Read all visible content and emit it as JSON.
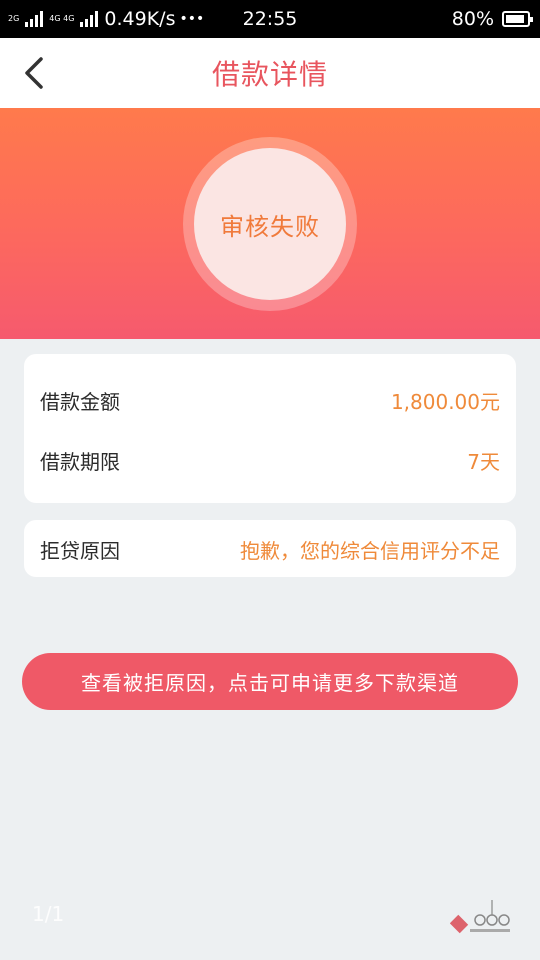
{
  "status_bar": {
    "net_tags": [
      "2G",
      "4G 4G"
    ],
    "speed": "0.49K/s",
    "dots": "•••",
    "time": "22:55",
    "battery_pct": "80%"
  },
  "nav": {
    "back_icon": "chevron-left-icon",
    "title": "借款详情"
  },
  "hero": {
    "status": "审核失败"
  },
  "details": {
    "rows": [
      {
        "label": "借款金额",
        "value": "1,800.00元"
      },
      {
        "label": "借款期限",
        "value": "7天"
      }
    ]
  },
  "reject": {
    "label": "拒贷原因",
    "value": "抱歉，您的综合信用评分不足"
  },
  "cta": {
    "label": "查看被拒原因，点击可申请更多下款渠道"
  },
  "footer": {
    "page_indicator": "1/1"
  },
  "colors": {
    "accent": "#e8555e",
    "value_orange": "#ef8a3a",
    "cta_bg": "#ef5967",
    "hero_top": "#ff7a4c",
    "hero_bottom": "#f65a6e"
  }
}
